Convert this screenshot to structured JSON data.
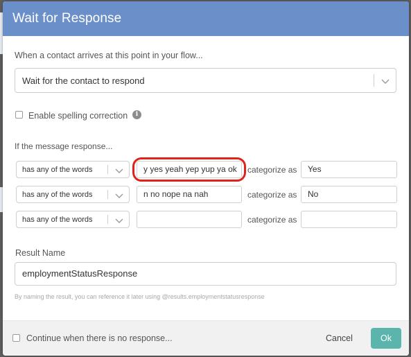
{
  "dialog": {
    "title": "Wait for Response"
  },
  "arrival": {
    "label": "When a contact arrives at this point in your flow...",
    "selected": "Wait for the contact to respond",
    "icon": "chevron-down-icon"
  },
  "spelling": {
    "label": "Enable spelling correction",
    "checked": false,
    "info_icon": "info-icon"
  },
  "rules": {
    "section_label": "If the message response...",
    "rows": [
      {
        "operator": "has any of the words",
        "arguments": "y yes yeah yep yup ya ok",
        "categorize_label": "categorize as",
        "category": "Yes"
      },
      {
        "operator": "has any of the words",
        "arguments": "n no nope na nah",
        "categorize_label": "categorize as",
        "category": "No"
      },
      {
        "operator": "has any of the words",
        "arguments": "",
        "categorize_label": "categorize as",
        "category": ""
      }
    ],
    "highlight_color": "#e0231a"
  },
  "result": {
    "label": "Result Name",
    "value": "employmentStatusResponse",
    "help": "By naming the result, you can reference it later using @results.employmentstatusresponse"
  },
  "footer": {
    "no_response_label": "Continue when there is no response...",
    "no_response_checked": false,
    "cancel_label": "Cancel",
    "ok_label": "Ok"
  },
  "colors": {
    "header": "#6b8fc9",
    "ok_button": "#5bb5ac",
    "backdrop": "#5f5f5f"
  }
}
